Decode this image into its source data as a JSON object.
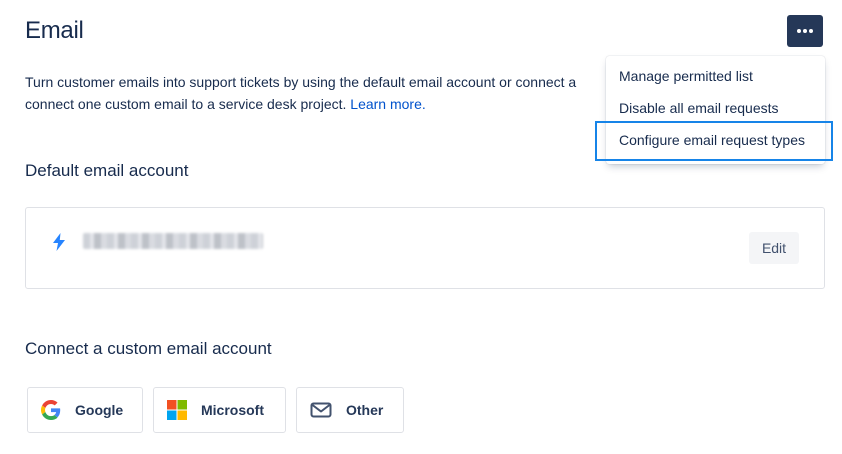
{
  "header": {
    "title": "Email",
    "more_button_icon": "more-horizontal-icon"
  },
  "intro": {
    "line1": "Turn customer emails into support tickets by using the default email account or connect a",
    "line2": "connect one custom email to a service desk project.",
    "learn_more": "Learn more."
  },
  "dropdown": {
    "items": [
      {
        "label": "Manage permitted list"
      },
      {
        "label": "Disable all email requests"
      },
      {
        "label": "Configure email request types",
        "highlighted": true
      }
    ],
    "highlight_color": "#1684e8"
  },
  "default_account": {
    "title": "Default email account",
    "icon": "lightning-bolt-icon",
    "email": "[redacted]",
    "edit_label": "Edit"
  },
  "custom_account": {
    "title": "Connect a custom email account",
    "providers": [
      {
        "label": "Google",
        "icon": "google-icon"
      },
      {
        "label": "Microsoft",
        "icon": "microsoft-icon"
      },
      {
        "label": "Other",
        "icon": "mail-icon"
      }
    ]
  },
  "colors": {
    "text": "#172b4d",
    "link": "#0052cc",
    "more_button_bg": "#253858",
    "bolt": "#2684ff"
  }
}
